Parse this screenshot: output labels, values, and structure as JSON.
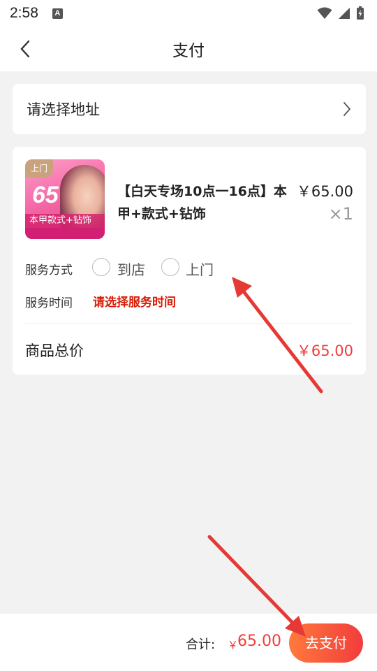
{
  "status_bar": {
    "time": "2:58",
    "notification_icon": "a-notification-icon",
    "wifi_icon": "wifi-icon",
    "signal_icon": "signal-icon",
    "battery_icon": "battery-charging-icon"
  },
  "header": {
    "title": "支付",
    "back_icon": "chevron-left-icon"
  },
  "address": {
    "placeholder": "请选择地址",
    "chevron_icon": "chevron-right-icon"
  },
  "product": {
    "thumbnail": {
      "badge": "上门",
      "big_text": "65",
      "caption": "本甲款式+钻饰"
    },
    "name": "【白天专场10点一16点】本甲+款式+钻饰",
    "price": "￥65.00",
    "quantity": "×1"
  },
  "service": {
    "method_label": "服务方式",
    "options": [
      "到店",
      "上门"
    ],
    "time_label": "服务时间",
    "time_placeholder": "请选择服务时间"
  },
  "total": {
    "label": "商品总价",
    "value": "￥65.00"
  },
  "footer": {
    "sum_label": "合计:",
    "currency": "￥",
    "sum_value": "65.00",
    "pay_button": "去支付"
  },
  "colors": {
    "accent": "#f23c3c",
    "alert_text": "#d81e06",
    "annotation": "#e53935"
  }
}
